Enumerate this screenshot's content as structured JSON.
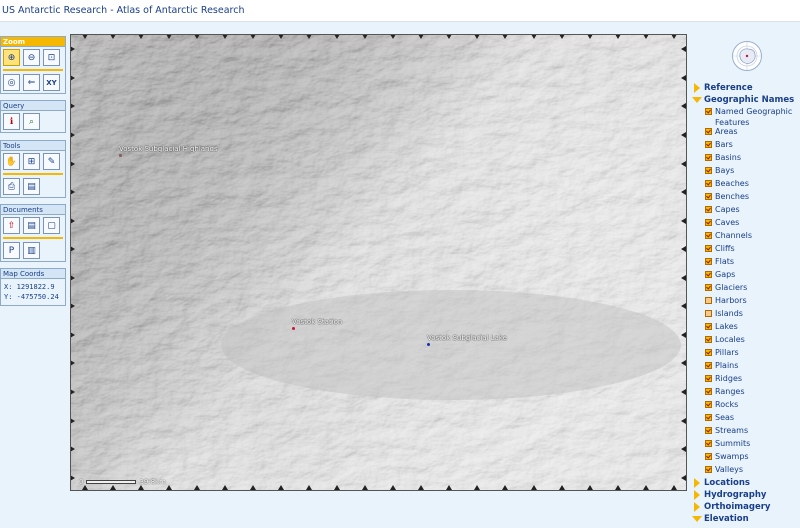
{
  "header": {
    "title": "US Antarctic Research - Atlas of Antarctic Research",
    "faint_link_1": "",
    "faint_link_2": ""
  },
  "toolbar": {
    "zoom": {
      "title": "Zoom",
      "tools": [
        {
          "icon": "zoom-in-icon",
          "glyph": "⊕",
          "selected": true
        },
        {
          "icon": "zoom-out-icon",
          "glyph": "⊖"
        },
        {
          "icon": "zoom-window-icon",
          "glyph": "⊡"
        },
        {
          "icon": "zoom-full-icon",
          "glyph": "◎"
        },
        {
          "icon": "zoom-back-icon",
          "glyph": "⇐"
        },
        {
          "icon": "zoom-xy-icon",
          "glyph": "XY"
        }
      ]
    },
    "query": {
      "title": "Query",
      "tools": [
        {
          "icon": "identify-icon",
          "glyph": "ℹ"
        },
        {
          "icon": "find-icon",
          "glyph": "⌕"
        }
      ]
    },
    "tools": {
      "title": "Tools",
      "tools": [
        {
          "icon": "pan-hand-icon",
          "glyph": "✋"
        },
        {
          "icon": "measure-icon",
          "glyph": "⊞"
        },
        {
          "icon": "erase-icon",
          "glyph": "✎"
        },
        {
          "icon": "print-icon",
          "glyph": "⎙"
        },
        {
          "icon": "layer-icon",
          "glyph": "▤"
        }
      ]
    },
    "documents": {
      "title": "Documents",
      "tools": [
        {
          "icon": "upload-icon",
          "glyph": "⇧"
        },
        {
          "icon": "document-icon",
          "glyph": "▤"
        },
        {
          "icon": "window-icon",
          "glyph": "▢"
        },
        {
          "icon": "pdf-icon",
          "glyph": "P"
        },
        {
          "icon": "book-icon",
          "glyph": "▥"
        }
      ]
    },
    "coords": {
      "title": "Map Coords",
      "x": "X: 1291822.9",
      "y": "Y: -475750.24"
    }
  },
  "map": {
    "places": [
      {
        "name": "Vostok Subglacial Highlands"
      },
      {
        "name": "Vostok Station"
      },
      {
        "name": "Vostok Subglacial Lake"
      }
    ],
    "scale": {
      "zero": "0",
      "label": "39.8km"
    }
  },
  "layers": {
    "reference": "Reference",
    "geographic_names": "Geographic Names",
    "items": [
      {
        "label": "Named Geographic Features",
        "checked": true
      },
      {
        "label": "Areas",
        "checked": true
      },
      {
        "label": "Bars",
        "checked": true
      },
      {
        "label": "Basins",
        "checked": true
      },
      {
        "label": "Bays",
        "checked": true
      },
      {
        "label": "Beaches",
        "checked": true
      },
      {
        "label": "Benches",
        "checked": true
      },
      {
        "label": "Capes",
        "checked": true
      },
      {
        "label": "Caves",
        "checked": true
      },
      {
        "label": "Channels",
        "checked": true
      },
      {
        "label": "Cliffs",
        "checked": true
      },
      {
        "label": "Flats",
        "checked": true
      },
      {
        "label": "Gaps",
        "checked": true
      },
      {
        "label": "Glaciers",
        "checked": true
      },
      {
        "label": "Harbors",
        "checked": false
      },
      {
        "label": "Islands",
        "checked": false
      },
      {
        "label": "Lakes",
        "checked": true
      },
      {
        "label": "Locales",
        "checked": true
      },
      {
        "label": "Pillars",
        "checked": true
      },
      {
        "label": "Plains",
        "checked": true
      },
      {
        "label": "Ridges",
        "checked": true
      },
      {
        "label": "Ranges",
        "checked": true
      },
      {
        "label": "Rocks",
        "checked": true
      },
      {
        "label": "Seas",
        "checked": true
      },
      {
        "label": "Streams",
        "checked": true
      },
      {
        "label": "Summits",
        "checked": true
      },
      {
        "label": "Swamps",
        "checked": true
      },
      {
        "label": "Valleys",
        "checked": true
      }
    ],
    "locations": "Locations",
    "hydrography": "Hydrography",
    "orthoimagery": "Orthoimagery",
    "elevation": "Elevation"
  }
}
